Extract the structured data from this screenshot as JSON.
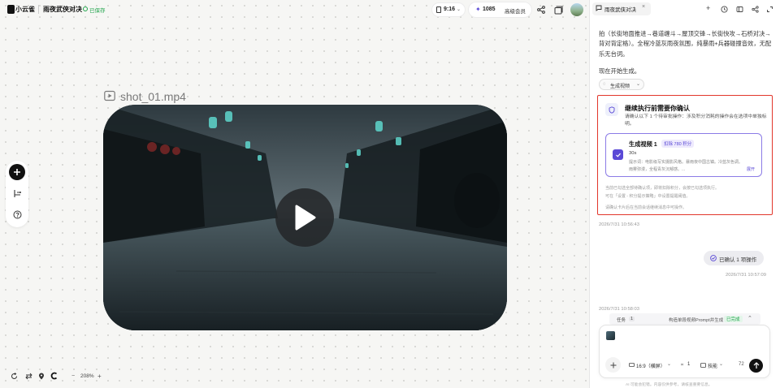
{
  "app": {
    "name": "小云雀",
    "project_title": "雨夜武侠对决",
    "save_status": "已保存"
  },
  "toolbar": {
    "time": "9:16",
    "credits": "1085",
    "member_label": "高级会员"
  },
  "canvas": {
    "file_name": "shot_01.mp4",
    "zoom": "208%"
  },
  "sidebar": {
    "tab_label": "雨夜武侠对决",
    "message_text": "拍（长街地面推进→巷道缠斗→屋顶交锋→长街快攻→石桥对决→背对背定格）。全程冷蓝灰雨夜氛围，纯暴雨+兵器碰撞音效，无配乐无台词。",
    "message_text2": "现在开始生成。",
    "gen_chip_label": "生成视频",
    "confirm": {
      "title": "继续执行前需要你确认",
      "desc": "请确认以下 1 个待审批操作：涉及积分消耗的操作会在选项中单独标明。",
      "card_title": "生成视频 1",
      "card_badge": "扣除 780 积分",
      "card_duration": "30s",
      "card_prompt": "提示词：电影级写实摄影风格。暴雨夜中国古镇。冷蓝灰色调。雨雾弥漫，全程青灰沉郁感。...",
      "card_expand": "展开",
      "note1": "当前已勾选全部待确认项，即将扣除积分，会按已勾选项执行。",
      "note2": "可在「设置 - 积分提示策略」中设置提醒阈值。",
      "note3": "请确认卡片后在当前会话继续消息中可操作。"
    },
    "timestamp1": "2026/7/31 10:56:43",
    "confirm_pill_label": "已确认 1 项操作",
    "timestamp2": "2026/7/31 10:57:09",
    "timestamp3": "2026/7/31 10:58:03",
    "task_label": "任务",
    "task_count": "1",
    "task_text": "构造单段视频Prompt并生成",
    "task_status": "已完成",
    "input": {
      "ratio": "16:9（横屏）",
      "count": "1",
      "mode": "技能",
      "char_count": "72"
    },
    "footer": "AI 可能会犯错。内容仅供参考，请核查重要信息。"
  },
  "colors": {
    "accent_red": "#e2362b",
    "accent_purple": "#5a49d6",
    "status_green": "#1fa34a"
  }
}
